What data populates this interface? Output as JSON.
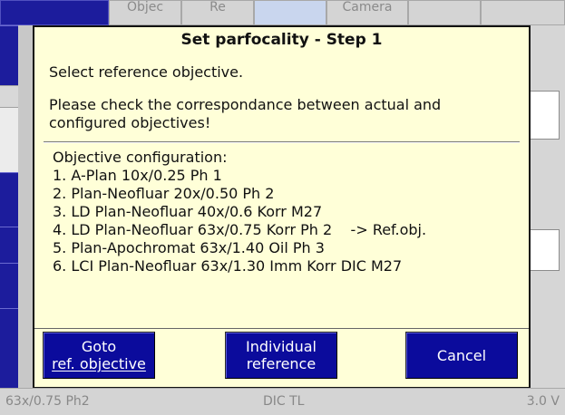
{
  "background": {
    "tabs": [
      "Objec",
      "Re",
      "",
      "Camera",
      ""
    ],
    "status": {
      "objective": "63x/0.75 Ph2",
      "contrast": "DIC TL",
      "voltage": "3.0 V"
    }
  },
  "dialog": {
    "title": "Set parfocality - Step 1",
    "instruction": "Select reference objective.",
    "warning_line1": "Please check the correspondance between actual and",
    "warning_line2": "configured objectives!",
    "config_heading": "Objective configuration:",
    "objectives": [
      "1. A-Plan 10x/0.25 Ph 1",
      "2. Plan-Neofluar 20x/0.50 Ph 2",
      "3. LD Plan-Neofluar 40x/0.6 Korr M27",
      "4. LD Plan-Neofluar 63x/0.75 Korr Ph 2    -> Ref.obj.",
      "5. Plan-Apochromat 63x/1.40 Oil Ph 3",
      "6. LCI Plan-Neofluar 63x/1.30 Imm Korr DIC M27"
    ],
    "buttons": {
      "goto_line1": "Goto",
      "goto_line2": "ref. objective",
      "individual_line1": "Individual",
      "individual_line2": "reference",
      "cancel": "Cancel"
    }
  },
  "colors": {
    "dialog_bg": "#ffffd8",
    "button_bg": "#0b0b9c",
    "accent_dark_blue": "#1c1c9c"
  }
}
